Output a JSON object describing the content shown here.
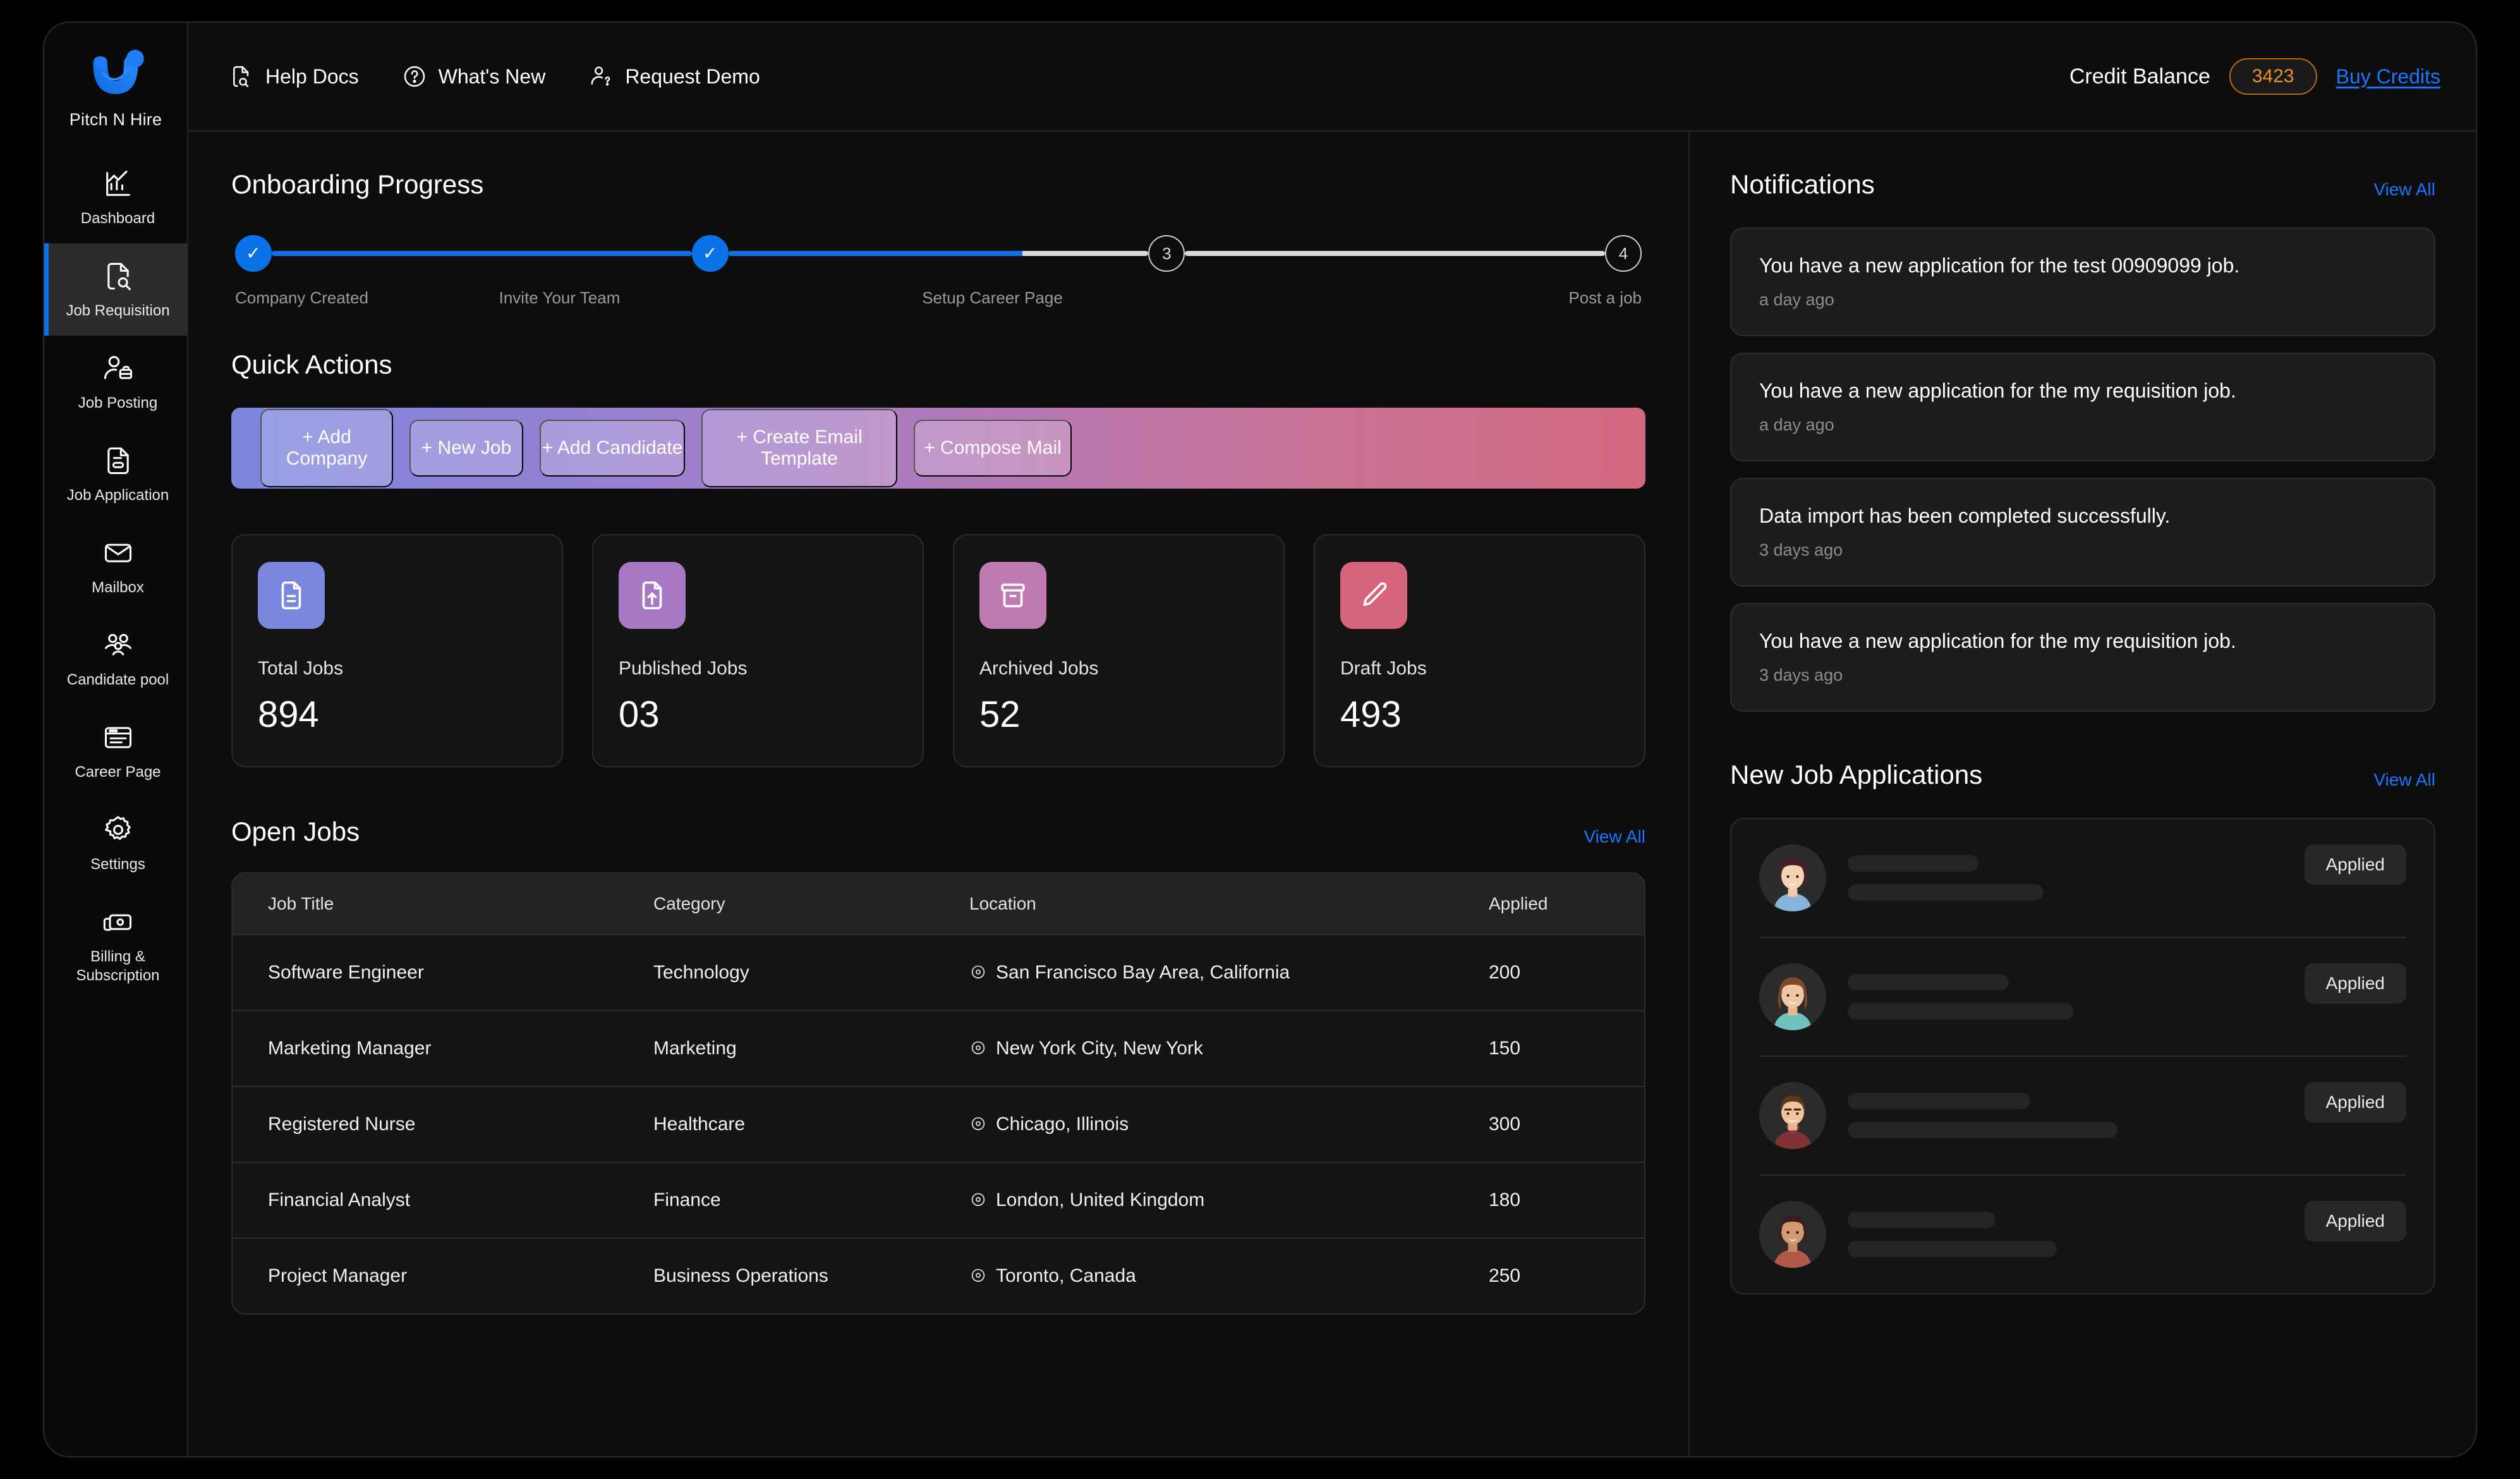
{
  "brand": {
    "name": "Pitch N Hire",
    "logo_icon": "pitch-n-hire-smile-logo"
  },
  "sidebar": {
    "items": [
      {
        "label": "Dashboard",
        "icon": "chart-bar-icon",
        "active": false
      },
      {
        "label": "Job Requisition",
        "icon": "document-search-icon",
        "active": true
      },
      {
        "label": "Job Posting",
        "icon": "person-briefcase-icon",
        "active": false
      },
      {
        "label": "Job Application",
        "icon": "document-list-icon",
        "active": false
      },
      {
        "label": "Mailbox",
        "icon": "envelope-icon",
        "active": false
      },
      {
        "label": "Candidate pool",
        "icon": "people-group-icon",
        "active": false
      },
      {
        "label": "Career Page",
        "icon": "browser-window-icon",
        "active": false
      },
      {
        "label": "Settings",
        "icon": "gear-icon",
        "active": false
      },
      {
        "label": "Billing & Subscription",
        "icon": "cards-stack-icon",
        "active": false
      }
    ]
  },
  "topbar": {
    "links": [
      {
        "label": "Help Docs",
        "icon": "document-search-icon"
      },
      {
        "label": "What's New",
        "icon": "question-circle-icon"
      },
      {
        "label": "Request Demo",
        "icon": "person-question-icon"
      }
    ],
    "credit_label": "Credit Balance",
    "credit_value": "3423",
    "buy_credits": "Buy Credits",
    "credit_pill_color": "#e8902d",
    "link_color": "#1976ff"
  },
  "onboarding": {
    "title": "Onboarding Progress",
    "steps": [
      {
        "label": "Company Created",
        "marker": "✓",
        "done": true
      },
      {
        "label": "Invite Your Team",
        "marker": "✓",
        "done": true
      },
      {
        "label": "Setup Career Page",
        "marker": "3",
        "done": false
      },
      {
        "label": "Post a job",
        "marker": "4",
        "done": false
      }
    ],
    "connector_fill_pct": [
      100,
      70,
      0
    ],
    "accent_color": "#0b72e7"
  },
  "quick_actions": {
    "title": "Quick Actions",
    "buttons": [
      {
        "label": "+ Add Company"
      },
      {
        "label": "+ New Job"
      },
      {
        "label": "+ Add Candidate"
      },
      {
        "label": "+ Create Email Template"
      },
      {
        "label": "+ Compose Mail"
      }
    ],
    "gradient_from": "#7b86de",
    "gradient_to": "#d3687f"
  },
  "stats": [
    {
      "label": "Total Jobs",
      "value": "894",
      "icon": "document-lines-icon",
      "color": "#7b86de"
    },
    {
      "label": "Published Jobs",
      "value": "03",
      "icon": "document-upload-icon",
      "color": "#a779c4"
    },
    {
      "label": "Archived Jobs",
      "value": "52",
      "icon": "archive-box-icon",
      "color": "#c07bb0"
    },
    {
      "label": "Draft Jobs",
      "value": "493",
      "icon": "pencil-icon",
      "color": "#d6647d"
    }
  ],
  "open_jobs": {
    "title": "Open Jobs",
    "view_all": "View All",
    "columns": [
      "Job Title",
      "Category",
      "Location",
      "Applied"
    ],
    "rows": [
      {
        "title": "Software Engineer",
        "category": "Technology",
        "location": "San Francisco Bay Area, California",
        "applied": "200"
      },
      {
        "title": "Marketing Manager",
        "category": "Marketing",
        "location": "New York City, New York",
        "applied": "150"
      },
      {
        "title": "Registered Nurse",
        "category": "Healthcare",
        "location": "Chicago, Illinois",
        "applied": "300"
      },
      {
        "title": "Financial Analyst",
        "category": "Finance",
        "location": "London, United Kingdom",
        "applied": "180"
      },
      {
        "title": "Project Manager",
        "category": "Business Operations",
        "location": "Toronto, Canada",
        "applied": "250"
      }
    ]
  },
  "notifications": {
    "title": "Notifications",
    "view_all": "View All",
    "items": [
      {
        "text": "You have a new application for the test 00909099 job.",
        "time": "a day ago"
      },
      {
        "text": "You have a new application for the my requisition job.",
        "time": "a day ago"
      },
      {
        "text": "Data import has been completed successfully.",
        "time": "3 days ago"
      },
      {
        "text": "You have a new application for the my requisition job.",
        "time": "3 days ago"
      }
    ]
  },
  "new_applications": {
    "title": "New Job Applications",
    "view_all": "View All",
    "items": [
      {
        "avatar": "avatar-woman-dark-red-hair",
        "status": "Applied",
        "skel_widths": [
          "30%",
          "45%"
        ]
      },
      {
        "avatar": "avatar-woman-brown-hair",
        "status": "Applied",
        "skel_widths": [
          "37%",
          "52%"
        ]
      },
      {
        "avatar": "avatar-man-brown-hair",
        "status": "Applied",
        "skel_widths": [
          "42%",
          "62%"
        ]
      },
      {
        "avatar": "avatar-woman-bob-hair",
        "status": "Applied",
        "skel_widths": [
          "34%",
          "48%"
        ]
      }
    ]
  }
}
